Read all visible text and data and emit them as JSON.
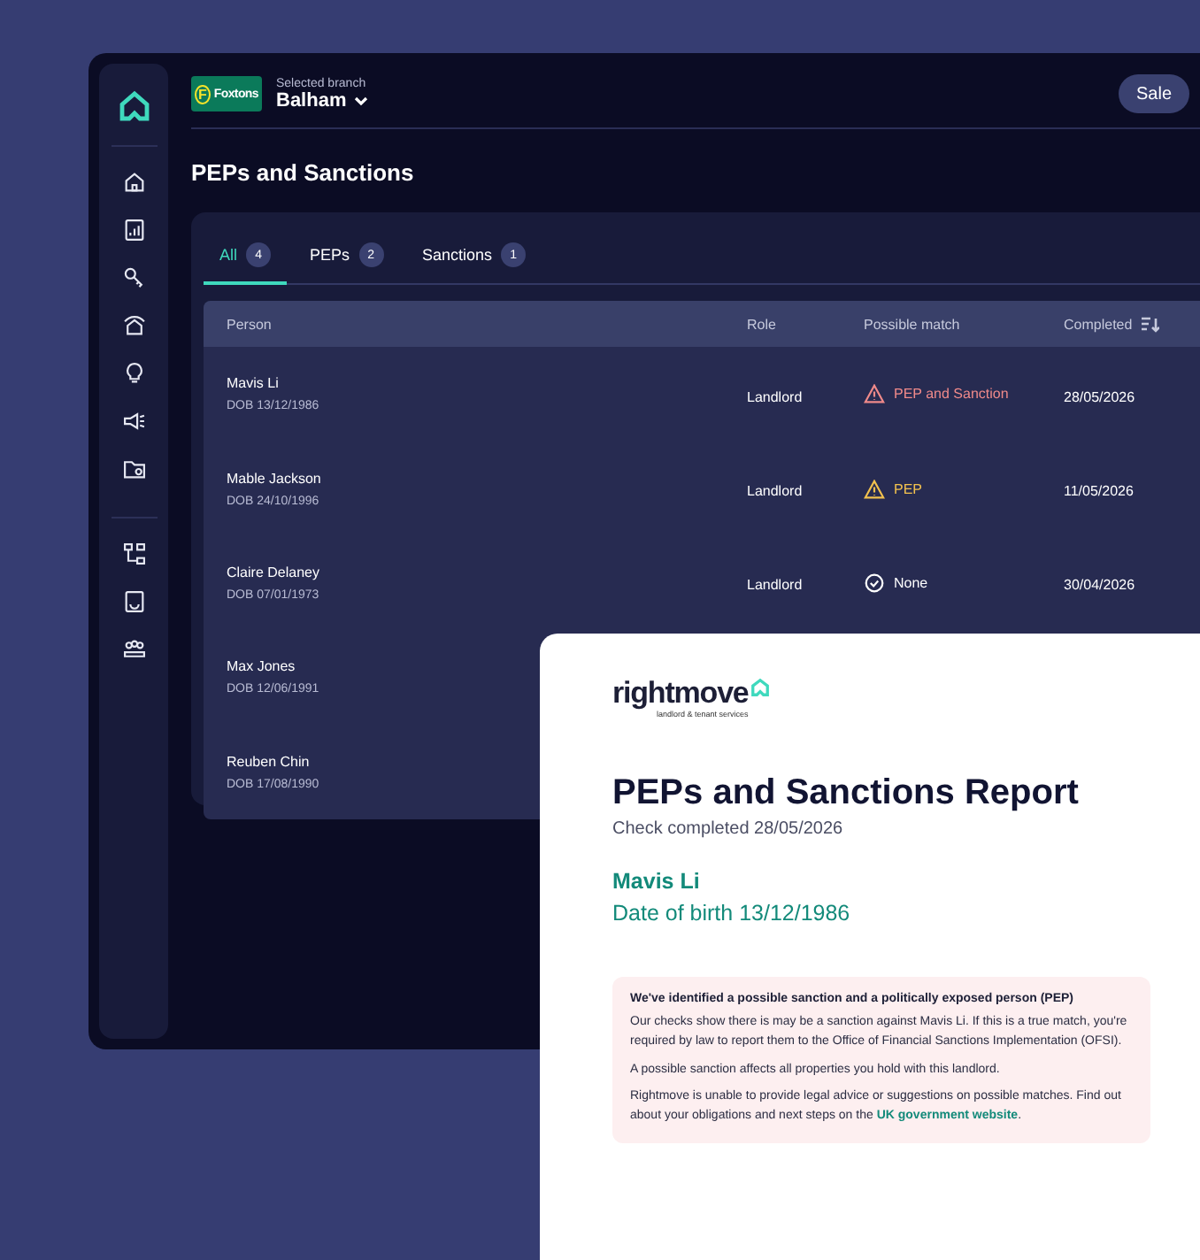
{
  "header": {
    "logo_mark": "F",
    "logo_text": "Foxtons",
    "branch_label": "Selected branch",
    "branch": "Balham",
    "button": "Sale"
  },
  "page_title": "PEPs and Sanctions",
  "tabs": [
    {
      "label": "All",
      "count": "4",
      "selected": true
    },
    {
      "label": "PEPs",
      "count": "2",
      "selected": false
    },
    {
      "label": "Sanctions",
      "count": "1",
      "selected": false
    }
  ],
  "table": {
    "columns": [
      "Person",
      "Role",
      "Possible match",
      "Completed"
    ],
    "rows": [
      {
        "name": "Mavis Li",
        "dob": "DOB 13/12/1986",
        "role": "Landlord",
        "match": "PEP and Sanction",
        "kind": "sanction",
        "completed": "28/05/2026"
      },
      {
        "name": "Mable Jackson",
        "dob": "DOB 24/10/1996",
        "role": "Landlord",
        "match": "PEP",
        "kind": "pep",
        "completed": "11/05/2026"
      },
      {
        "name": "Claire Delaney",
        "dob": "DOB 07/01/1973",
        "role": "Landlord",
        "match": "None",
        "kind": "none",
        "completed": "30/04/2026"
      },
      {
        "name": "Max Jones",
        "dob": "DOB 12/06/1991"
      },
      {
        "name": "Reuben Chin",
        "dob": "DOB 17/08/1990"
      }
    ]
  },
  "report": {
    "brand": "rightmove",
    "brand_sub": "landlord & tenant services",
    "title": "PEPs and Sanctions Report",
    "completed": "Check completed 28/05/2026",
    "person": "Mavis Li",
    "dob": "Date of birth 13/12/1986",
    "alert": {
      "heading": "We've identified a possible sanction and a politically exposed person (PEP)",
      "paragraphs": [
        {
          "text": "Our checks show there is may be a sanction against Mavis Li. If this is a true match, you're required by law to report them to the Office of Financial Sanctions Implementation (OFSI)."
        },
        {
          "text": "A possible sanction affects all properties you hold with this landlord."
        },
        {
          "text": "Rightmove is unable to provide legal advice or suggestions on possible matches. Find out about your obligations and next steps on the ",
          "link": "UK government website",
          "after": "."
        }
      ]
    }
  }
}
